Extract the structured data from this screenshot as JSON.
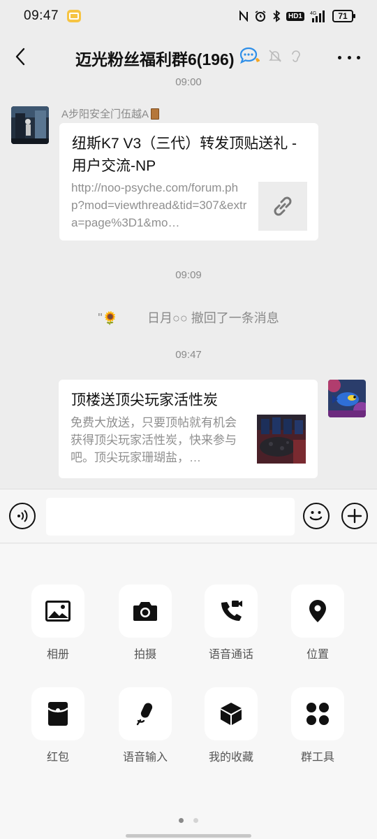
{
  "status_bar": {
    "time": "09:47",
    "battery": "71",
    "network": "4G",
    "hd": "HD1"
  },
  "header": {
    "title": "迈光粉丝福利群6(196)"
  },
  "messages": {
    "time1": "09:00",
    "msg1": {
      "sender": "A步阳安全门伍越A",
      "title": "纽斯K7 V3（三代）转发顶贴送礼 - 用户交流-NP",
      "desc": "http://noo-psyche.com/forum.php?mod=viewthread&tid=307&extra=page%3D1&mo…"
    },
    "time2": "09:09",
    "recall": {
      "name": "日月○○",
      "text": "撤回了一条消息"
    },
    "time3": "09:47",
    "msg2": {
      "title": "顶楼送顶尖玩家活性炭",
      "desc": "免费大放送，只要顶帖就有机会获得顶尖玩家活性炭，快来参与吧。顶尖玩家珊瑚盐，…"
    }
  },
  "input": {
    "placeholder": ""
  },
  "tools": [
    {
      "label": "相册",
      "icon": "image-icon"
    },
    {
      "label": "拍摄",
      "icon": "camera-icon"
    },
    {
      "label": "语音通话",
      "icon": "phone-video-icon"
    },
    {
      "label": "位置",
      "icon": "location-icon"
    },
    {
      "label": "红包",
      "icon": "red-packet-icon"
    },
    {
      "label": "语音输入",
      "icon": "microphone-icon"
    },
    {
      "label": "我的收藏",
      "icon": "favorites-box-icon"
    },
    {
      "label": "群工具",
      "icon": "group-tools-icon"
    }
  ],
  "colors": {
    "background": "#ededed",
    "bubble": "#ffffff",
    "panel": "#f7f7f7"
  }
}
